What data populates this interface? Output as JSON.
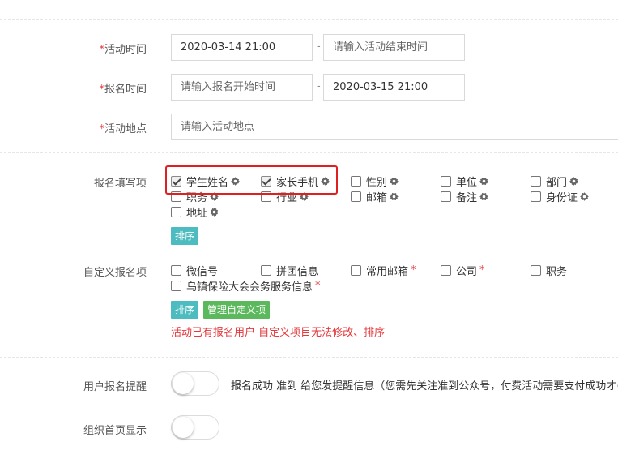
{
  "activity_time": {
    "label": "活动时间",
    "required_mark": "*",
    "start_value": "2020-03-14 21:00",
    "end_placeholder": "请输入活动结束时间",
    "separator": "-"
  },
  "signup_time": {
    "label": "报名时间",
    "required_mark": "*",
    "start_placeholder": "请输入报名开始时间",
    "end_value": "2020-03-15 21:00",
    "separator": "-"
  },
  "location": {
    "label": "活动地点",
    "required_mark": "*",
    "placeholder": "请输入活动地点"
  },
  "signup_fields": {
    "label": "报名填写项",
    "items": [
      {
        "label": "学生姓名",
        "checked": true
      },
      {
        "label": "家长手机",
        "checked": true
      },
      {
        "label": "性别",
        "checked": false
      },
      {
        "label": "单位",
        "checked": false
      },
      {
        "label": "部门",
        "checked": false
      },
      {
        "label": "职务",
        "checked": false
      },
      {
        "label": "行业",
        "checked": false
      },
      {
        "label": "邮箱",
        "checked": false
      },
      {
        "label": "备注",
        "checked": false
      },
      {
        "label": "身份证",
        "checked": false
      },
      {
        "label": "地址",
        "checked": false
      }
    ],
    "sort_button": "排序"
  },
  "custom_fields": {
    "label": "自定义报名项",
    "items": [
      {
        "label": "微信号",
        "required": ""
      },
      {
        "label": "拼团信息",
        "required": ""
      },
      {
        "label": "常用邮箱",
        "required": "*"
      },
      {
        "label": "公司",
        "required": "*"
      },
      {
        "label": "职务",
        "required": ""
      },
      {
        "label": "乌镇保险大会会务服务信息",
        "required": "*"
      }
    ],
    "sort_button": "排序",
    "manage_button": "管理自定义项",
    "warning": "活动已有报名用户 自定义项目无法修改、排序"
  },
  "reminder": {
    "label": "用户报名提醒",
    "enabled": false,
    "description": "报名成功 准到 给您发提醒信息（您需先关注准到公众号，付费活动需要支付成功才会"
  },
  "homepage_display": {
    "label": "组织首页显示",
    "enabled": false
  },
  "colors": {
    "required": "#e4393c",
    "teal_button": "#4cbcc0",
    "green_button": "#5cb85c",
    "highlight": "#e02020"
  }
}
